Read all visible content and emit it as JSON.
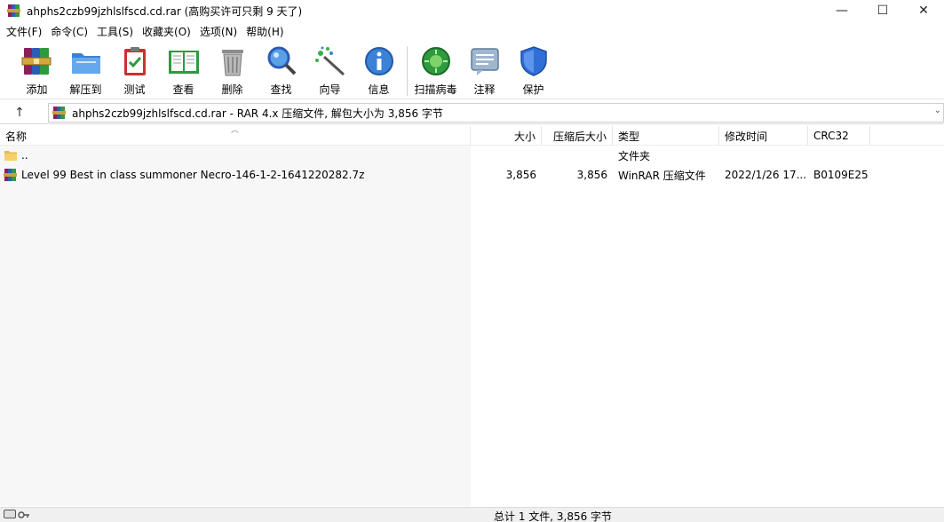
{
  "window": {
    "title": "ahphs2czb99jzhlslfscd.cd.rar (高购买许可只剩 9 天了)",
    "controls": {
      "minimize": "—",
      "maximize": "☐",
      "close": "✕"
    }
  },
  "menu": [
    {
      "id": "file",
      "label": "文件(F)"
    },
    {
      "id": "command",
      "label": "命令(C)"
    },
    {
      "id": "tools",
      "label": "工具(S)"
    },
    {
      "id": "favorites",
      "label": "收藏夹(O)"
    },
    {
      "id": "options",
      "label": "选项(N)"
    },
    {
      "id": "help",
      "label": "帮助(H)"
    }
  ],
  "toolbar": [
    {
      "id": "add",
      "label": "添加",
      "icon": "winrar-books-icon"
    },
    {
      "id": "extract",
      "label": "解压到",
      "icon": "folder-extract-icon"
    },
    {
      "id": "test",
      "label": "测试",
      "icon": "clipboard-check-icon"
    },
    {
      "id": "view",
      "label": "查看",
      "icon": "open-book-icon"
    },
    {
      "id": "delete",
      "label": "删除",
      "icon": "trash-icon"
    },
    {
      "id": "find",
      "label": "查找",
      "icon": "magnifier-icon"
    },
    {
      "id": "wizard",
      "label": "向导",
      "icon": "magic-wand-icon"
    },
    {
      "id": "info",
      "label": "信息",
      "icon": "info-icon"
    },
    {
      "id": "scan",
      "label": "扫描病毒",
      "icon": "virus-scan-icon"
    },
    {
      "id": "comment",
      "label": "注释",
      "icon": "comment-icon"
    },
    {
      "id": "protect",
      "label": "保护",
      "icon": "shield-icon"
    }
  ],
  "address": {
    "text": "ahphs2czb99jzhlslfscd.cd.rar - RAR 4.x 压缩文件, 解包大小为 3,856 字节",
    "up_glyph": "↑",
    "dropdown_glyph": "⌄"
  },
  "columns": [
    {
      "id": "name",
      "label": "名称"
    },
    {
      "id": "size",
      "label": "大小"
    },
    {
      "id": "packed",
      "label": "压缩后大小"
    },
    {
      "id": "type",
      "label": "类型"
    },
    {
      "id": "modified",
      "label": "修改时间"
    },
    {
      "id": "crc",
      "label": "CRC32"
    }
  ],
  "rows": [
    {
      "name": "..",
      "size": "",
      "packed": "",
      "type": "文件夹",
      "modified": "",
      "crc": "",
      "icon": "folder-icon"
    },
    {
      "name": "Level 99 Best in class summoner Necro-146-1-2-1641220282.7z",
      "size": "3,856",
      "packed": "3,856",
      "type": "WinRAR 压缩文件",
      "modified": "2022/1/26 17...",
      "crc": "B0109E25",
      "icon": "archive-icon"
    }
  ],
  "status": {
    "text": "总计 1 文件, 3,856 字节"
  },
  "colors": {
    "accent_green": "#2e9a3e",
    "shield_blue": "#2f6fd6",
    "winrar_red": "#b3262b"
  }
}
